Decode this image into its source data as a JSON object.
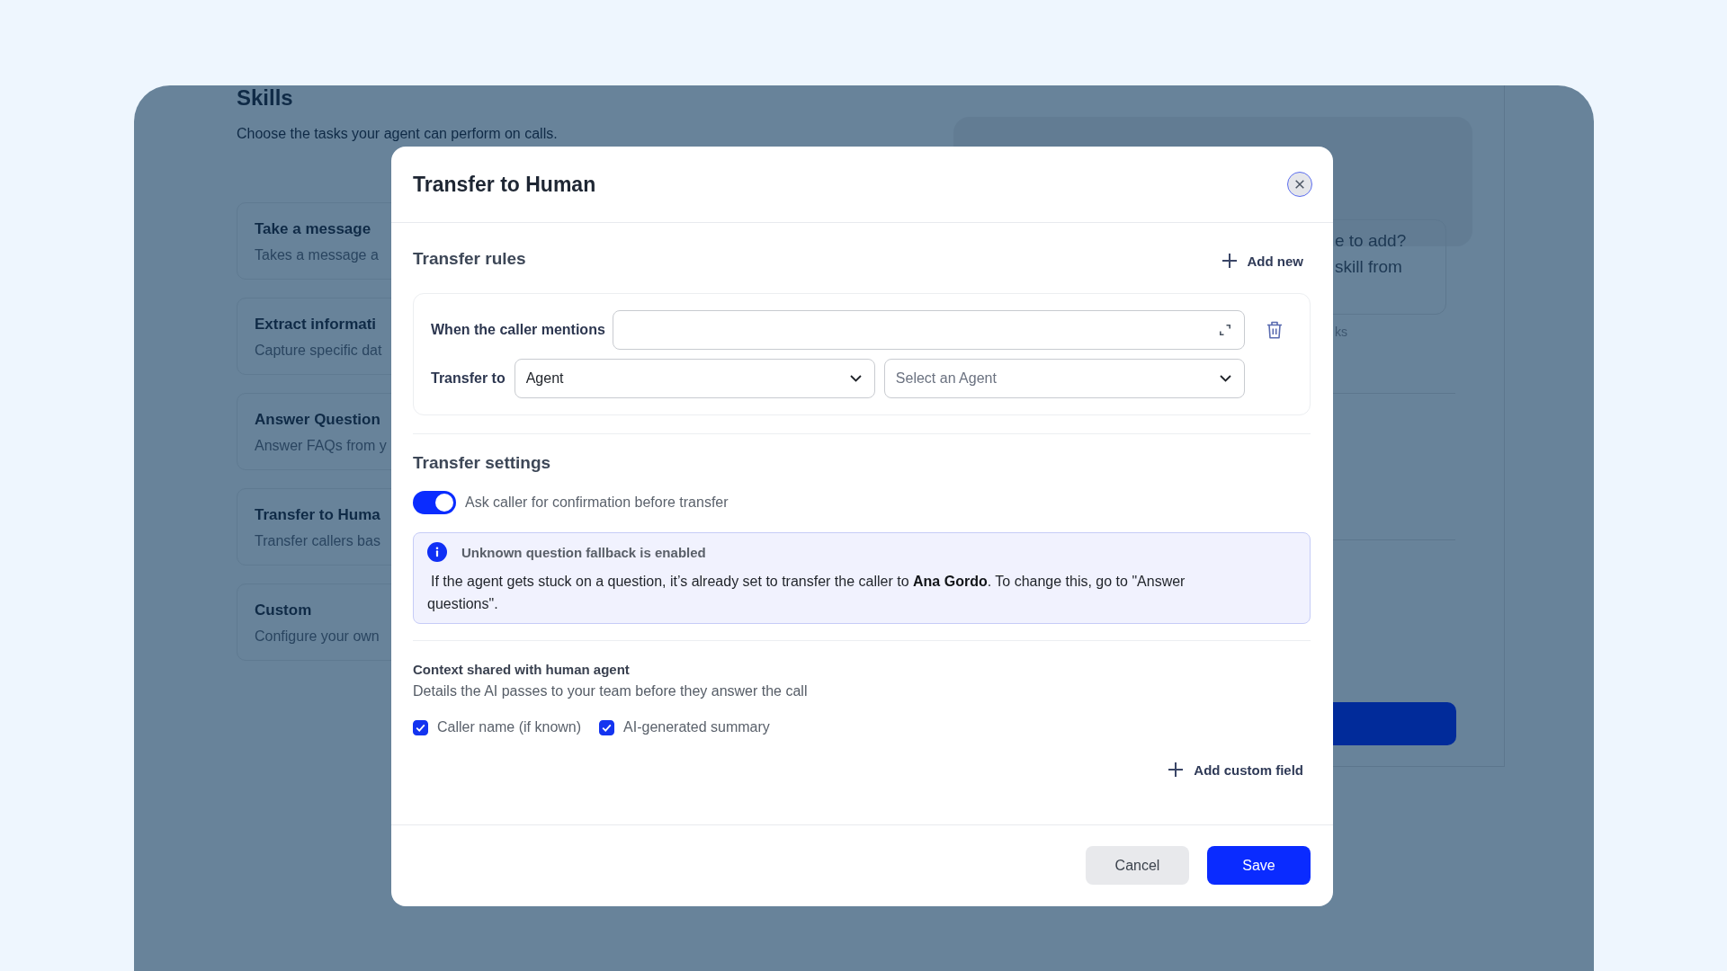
{
  "background_page": {
    "title": "Skills",
    "subtitle": "Choose the tasks your agent can perform on calls.",
    "skills": [
      {
        "name": "Take a message",
        "description": "Takes a message a"
      },
      {
        "name": "Extract informati",
        "description": "Capture specific dat"
      },
      {
        "name": "Answer Question",
        "description": "Answer FAQs from y"
      },
      {
        "name": "Transfer to Huma",
        "description": "Transfer callers bas"
      },
      {
        "name": "Custom",
        "description": "Configure your own"
      }
    ],
    "side_panel": {
      "card_lines": [
        "e to add?",
        "skill from"
      ],
      "caption": "ks"
    }
  },
  "dialog": {
    "title": "Transfer to Human",
    "transfer_rules": {
      "heading": "Transfer rules",
      "add_button": "Add new",
      "rules": [
        {
          "mention_label": "When the caller mentions",
          "target_label": "Transfer to",
          "target_type": {
            "value": "Agent"
          },
          "target_agent": {
            "placeholder": "Select an Agent"
          }
        }
      ]
    },
    "transfer_settings": {
      "heading": "Transfer settings",
      "confirmation_toggle": {
        "label": "Ask caller for confirmation before transfer",
        "on": true
      }
    },
    "notice": {
      "title": "Unknown question fallback is enabled",
      "text": "If the agent gets stuck on a question, it’s already set to transfer the caller to **Ana Gordo**. To change this, go to \"Answer questions\"."
    },
    "context": {
      "heading": "Context shared with human agent",
      "description": "Details the AI passes to your team before they answer the call",
      "fields": [
        {
          "label": "Caller name (if known)",
          "checked": true
        },
        {
          "label": "AI-generated summary",
          "checked": true
        }
      ],
      "add_button": "Add custom field"
    },
    "buttons": [
      {
        "label": "Cancel",
        "kind": "secondary"
      },
      {
        "label": "Save",
        "kind": "primary"
      }
    ]
  }
}
